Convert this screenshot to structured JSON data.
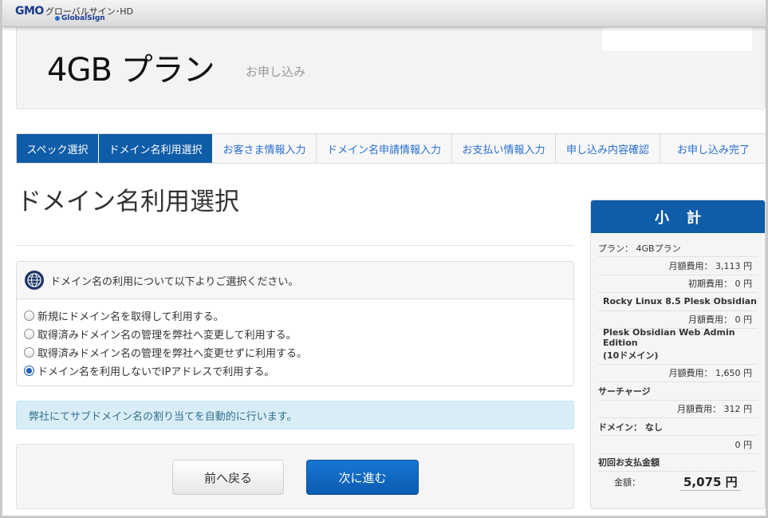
{
  "brand": {
    "logo_main": "GMO",
    "logo_jp": "グローバルサイン･HD",
    "logo_sub": "GlobalSign"
  },
  "header": {
    "plan_title": "4GB プラン",
    "plan_subtitle": "お申し込み"
  },
  "steps": [
    {
      "label": "スペック選択",
      "done": true
    },
    {
      "label": "ドメイン名利用選択",
      "done": true
    },
    {
      "label": "お客さま情報入力",
      "done": false
    },
    {
      "label": "ドメイン名申請情報入力",
      "done": false
    },
    {
      "label": "お支払い情報入力",
      "done": false
    },
    {
      "label": "申し込み内容確認",
      "done": false
    },
    {
      "label": "お申し込み完了",
      "done": false
    }
  ],
  "main": {
    "title": "ドメイン名利用選択",
    "panel_heading": "ドメイン名の利用について以下よりご選択ください。",
    "options": [
      {
        "label": "新規にドメイン名を取得して利用する。",
        "checked": false
      },
      {
        "label": "取得済みドメイン名の管理を弊社へ変更して利用する。",
        "checked": false
      },
      {
        "label": "取得済みドメイン名の管理を弊社へ変更せずに利用する。",
        "checked": false
      },
      {
        "label": "ドメイン名を利用しないでIPアドレスで利用する。",
        "checked": true
      }
    ],
    "info_text": "弊社にてサブドメイン名の割り当てを自動的に行います。",
    "back_button": "前へ戻る",
    "next_button": "次に進む"
  },
  "subtotal": {
    "heading": "小計",
    "plan_line": "プラン： 4GBプラン",
    "monthly_plan": "月額費用： 3,113 円",
    "initial_fee": "初期費用： 0 円",
    "os_name": "Rocky Linux 8.5 Plesk Obsidian",
    "monthly_os": "月額費用： 0 円",
    "plesk_name": "Plesk Obsidian Web Admin Edition",
    "plesk_domains": "(10ドメイン)",
    "monthly_plesk": "月額費用： 1,650 円",
    "surcharge_label": "サーチャージ",
    "monthly_surcharge": "月額費用： 312 円",
    "domain_line": "ドメイン： なし",
    "domain_fee": "0 円",
    "first_payment_label": "初回お支払金額",
    "total_label": "金額：",
    "total_value": "5,075 円"
  },
  "colors": {
    "primary": "#0f5ca8",
    "link": "#2a6fd0",
    "info_bg": "#d9edf7",
    "info_text": "#31708f"
  }
}
